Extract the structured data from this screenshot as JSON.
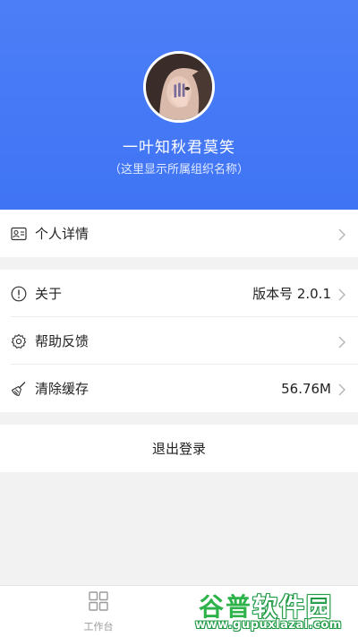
{
  "profile": {
    "name": "一叶知秋君莫笑",
    "org": "（这里显示所属组织名称）"
  },
  "menu": {
    "personal": {
      "label": "个人详情",
      "icon": "id-card-icon"
    },
    "about": {
      "label": "关于",
      "value": "版本号 2.0.1",
      "icon": "info-icon"
    },
    "help": {
      "label": "帮助反馈",
      "icon": "gear-icon"
    },
    "cache": {
      "label": "清除缓存",
      "value": "56.76M",
      "icon": "broom-icon"
    }
  },
  "logout_label": "退出登录",
  "tabbar": {
    "workbench": {
      "label": "工作台",
      "icon": "grid-icon"
    }
  },
  "watermark": {
    "title_a": "谷普",
    "title_b": "软件园",
    "url": "www.gupuxlazal.com"
  },
  "colors": {
    "header": "#4c7ef7",
    "background": "#f2f2f2",
    "watermark": "#2db34a"
  }
}
